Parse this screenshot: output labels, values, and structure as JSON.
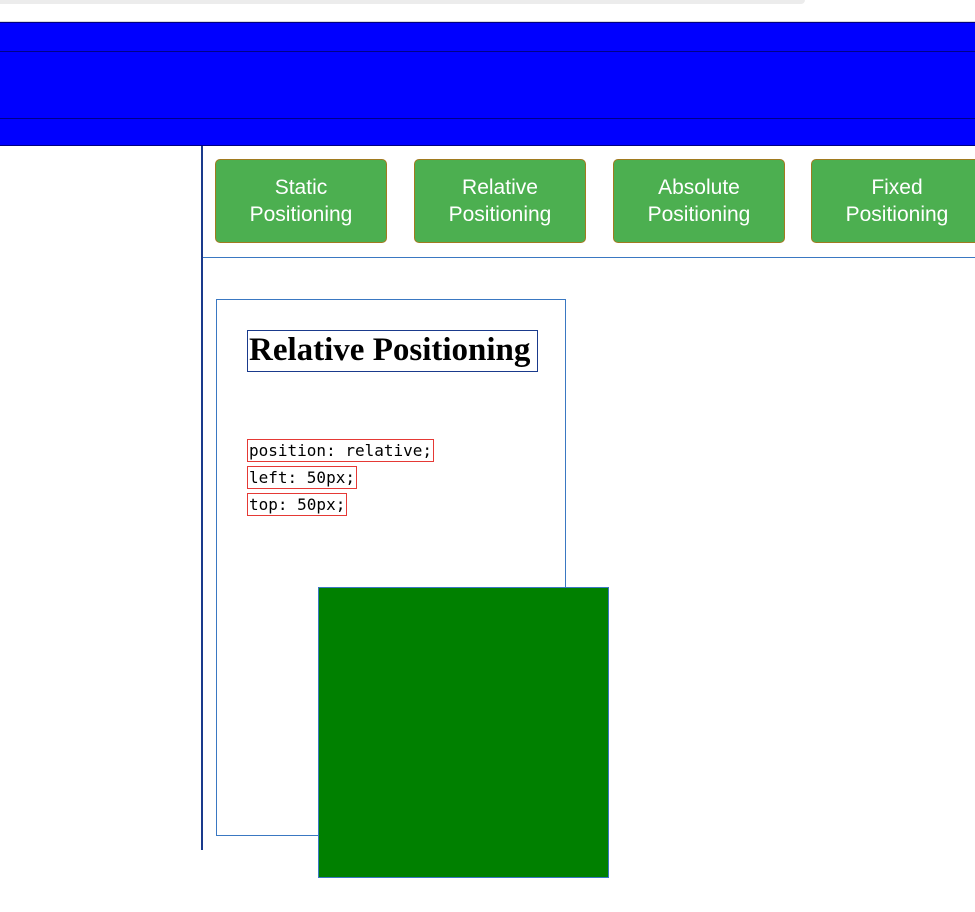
{
  "colors": {
    "header": "#0000ff",
    "nav_button": "#4caf50",
    "box": "#008000",
    "code_border": "#e53935",
    "container_border": "#3a78c2"
  },
  "nav": {
    "items": [
      {
        "label": "Static\nPositioning"
      },
      {
        "label": "Relative\nPositioning"
      },
      {
        "label": "Absolute\nPositioning"
      },
      {
        "label": "Fixed\nPositioning"
      }
    ]
  },
  "demo": {
    "heading": "Relative Positioning",
    "code_lines": [
      "position: relative;",
      "left: 50px;",
      "top: 50px;"
    ]
  }
}
